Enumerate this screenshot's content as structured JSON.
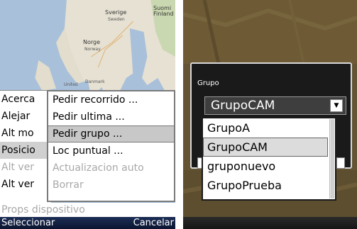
{
  "left_screen": {
    "map_labels": {
      "sweden": "Sverige",
      "sweden_sub": "Sweden",
      "finland": "Suomi\nFinland",
      "norway": "Norge",
      "norway_sub": "Norway",
      "denmark": "Danmark",
      "uk": "United"
    },
    "options_menu": [
      {
        "label": "Acerca",
        "state": "normal"
      },
      {
        "label": "Alejar",
        "state": "normal"
      },
      {
        "label": "Alt mo",
        "state": "normal"
      },
      {
        "label": "Posicio",
        "state": "selected"
      },
      {
        "label": "Alt ver",
        "state": "disabled"
      },
      {
        "label": "Alt ver",
        "state": "normal"
      }
    ],
    "props_item": "Props dispositivo",
    "submenu": [
      {
        "label": "Pedir recorrido ...",
        "state": "normal"
      },
      {
        "label": "Pedir ultima ...",
        "state": "normal"
      },
      {
        "label": "Pedir grupo ...",
        "state": "selected"
      },
      {
        "label": "Loc puntual ...",
        "state": "normal"
      },
      {
        "label": "Actualizacion auto",
        "state": "disabled"
      },
      {
        "label": "Borrar",
        "state": "disabled"
      }
    ],
    "softkeys": {
      "left": "Seleccionar",
      "right": "Cancelar"
    }
  },
  "right_screen": {
    "dialog": {
      "title": "Grupo",
      "selected_value": "GrupoCAM",
      "dropdown_icon": "triangle-down-icon"
    },
    "dropdown_options": [
      {
        "label": "GrupoA",
        "selected": false
      },
      {
        "label": "GrupoCAM",
        "selected": true
      },
      {
        "label": "gruponuevo",
        "selected": false
      },
      {
        "label": "GrupoPrueba",
        "selected": false
      }
    ]
  },
  "colors": {
    "softkey_bar": "#0f1c3d",
    "selection": "#c8c8c8",
    "disabled_text": "#a8a8a8"
  }
}
